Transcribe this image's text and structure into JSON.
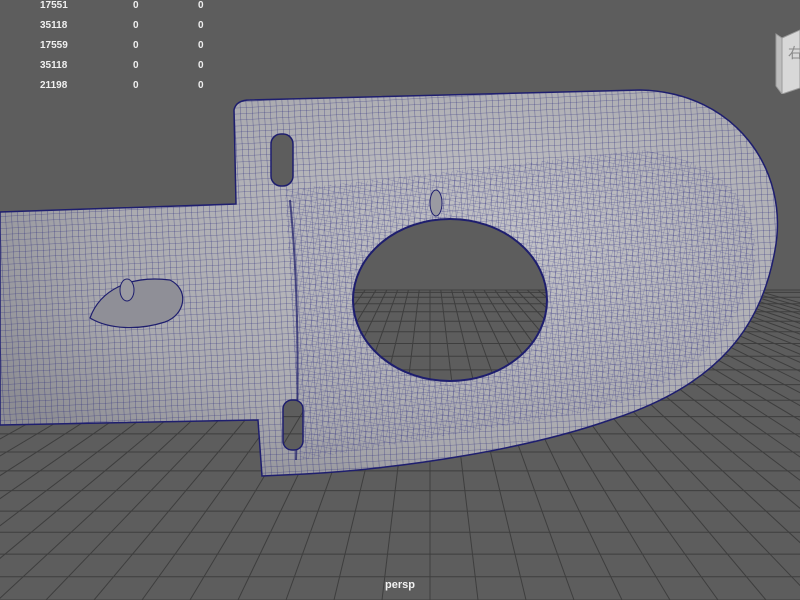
{
  "viewport": {
    "camera_name": "persp"
  },
  "hud_stats": {
    "rows": [
      [
        "17551",
        "0",
        "0"
      ],
      [
        "35118",
        "0",
        "0"
      ],
      [
        "17559",
        "0",
        "0"
      ],
      [
        "35118",
        "0",
        "0"
      ],
      [
        "21198",
        "0",
        "0"
      ]
    ]
  },
  "colors": {
    "background": "#5d5d5d",
    "grid": "#3e3e3e",
    "mesh_fill": "#aeaeb3",
    "wireframe": "#24247a",
    "hud_text": "#f0f0f0"
  },
  "icons": {
    "view_cube": "view-cube-icon"
  }
}
